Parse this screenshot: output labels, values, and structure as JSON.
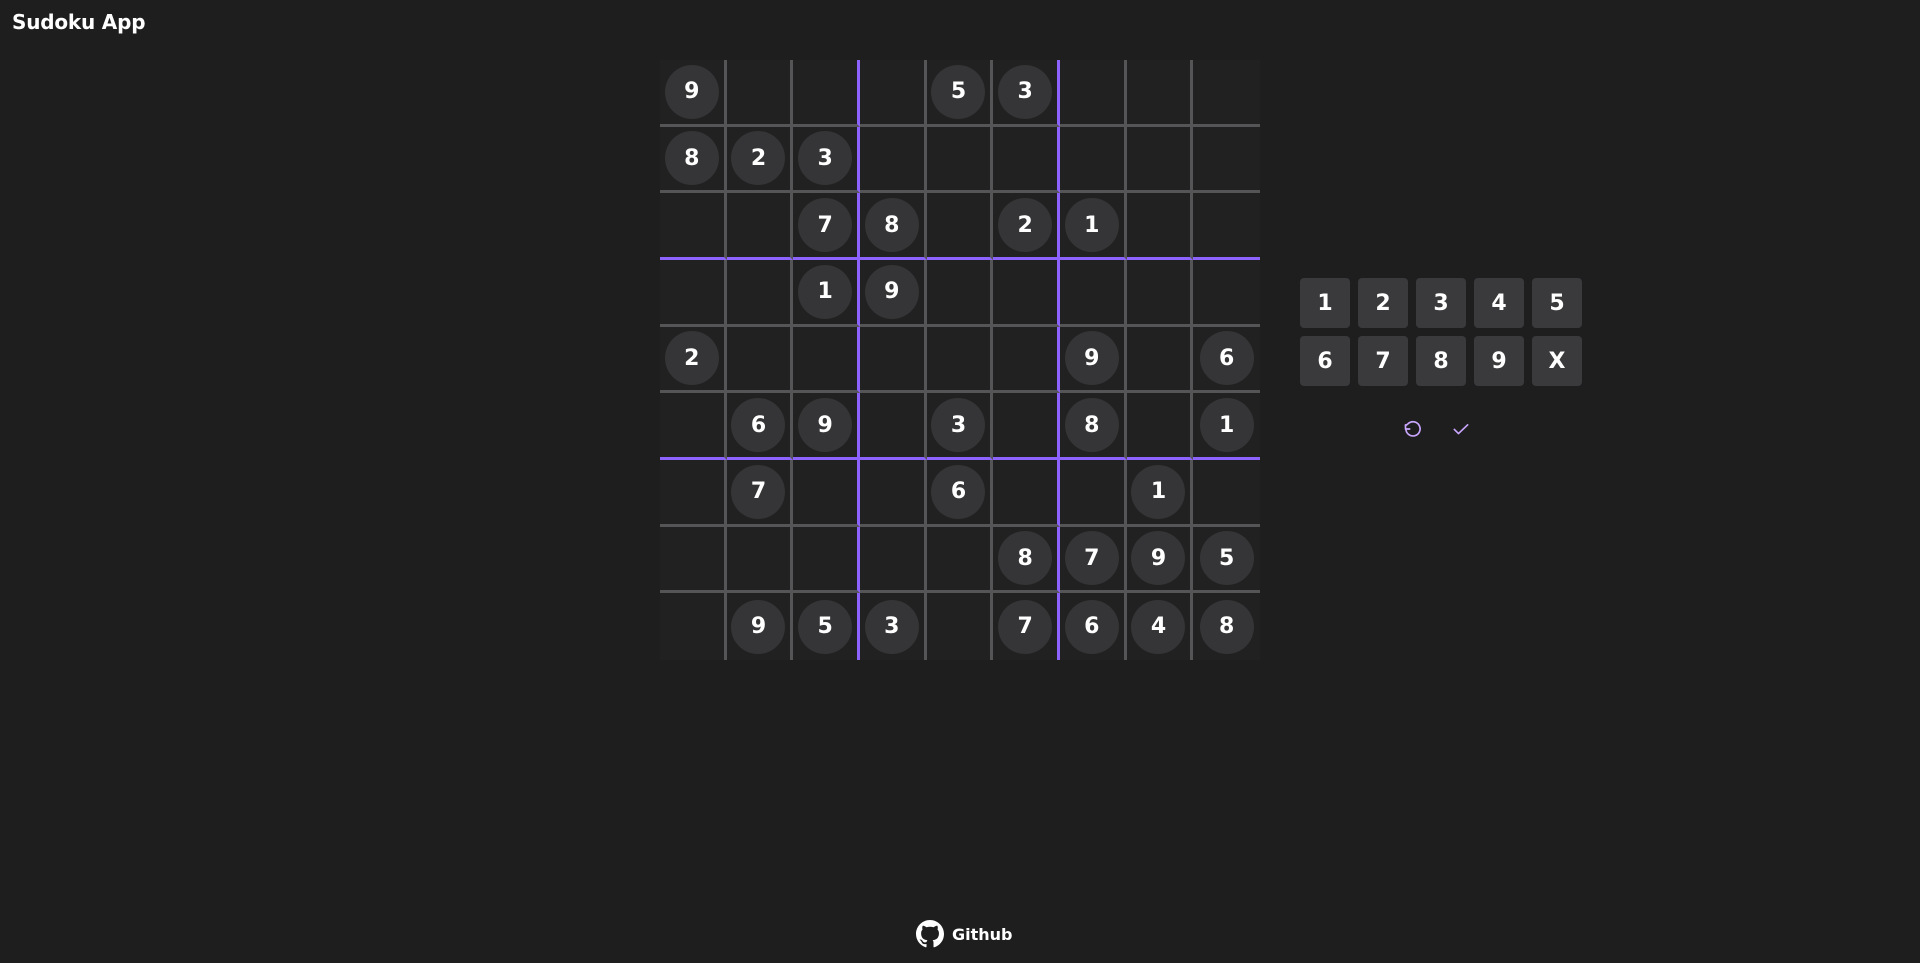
{
  "app": {
    "title": "Sudoku App"
  },
  "board": {
    "grid": [
      [
        "9",
        "",
        "",
        "",
        "5",
        "3",
        "",
        "",
        ""
      ],
      [
        "8",
        "2",
        "3",
        "",
        "",
        "",
        "",
        "",
        ""
      ],
      [
        "",
        "",
        "7",
        "8",
        "",
        "2",
        "1",
        "",
        ""
      ],
      [
        "",
        "",
        "1",
        "9",
        "",
        "",
        "",
        "",
        ""
      ],
      [
        "2",
        "",
        "",
        "",
        "",
        "",
        "9",
        "",
        "6"
      ],
      [
        "",
        "6",
        "9",
        "",
        "3",
        "",
        "8",
        "",
        "1"
      ],
      [
        "",
        "7",
        "",
        "",
        "6",
        "",
        "",
        "1",
        ""
      ],
      [
        "",
        "",
        "",
        "",
        "",
        "8",
        "7",
        "9",
        "5"
      ],
      [
        "",
        "9",
        "5",
        "3",
        "",
        "7",
        "6",
        "4",
        "8"
      ]
    ]
  },
  "keypad": {
    "keys": [
      "1",
      "2",
      "3",
      "4",
      "5",
      "6",
      "7",
      "8",
      "9",
      "X"
    ]
  },
  "actions": {
    "undo_icon": "undo-icon",
    "check_icon": "check-icon"
  },
  "footer": {
    "github_label": "Github",
    "github_icon": "github-icon"
  },
  "colors": {
    "background": "#1f1e1f",
    "box_border": "#8c63ff",
    "cell_border": "#555456",
    "number_circle": "#353436",
    "keypad_button": "#3a393b",
    "action_icon": "#c9a6ff"
  }
}
